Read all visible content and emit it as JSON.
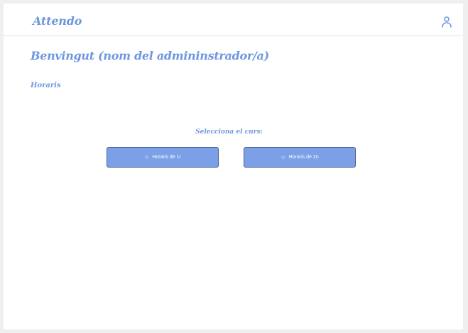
{
  "header": {
    "brand": "Attendo",
    "user_icon": "user-icon"
  },
  "main": {
    "welcome": "Benvingut (nom del admininstrador/a)",
    "section_title": "Horaris",
    "select_label": "Selecciona el curs:",
    "buttons": [
      {
        "icon": "star-icon",
        "label": "Horaris de 1r"
      },
      {
        "icon": "star-icon",
        "label": "Horaris de 2n"
      }
    ]
  },
  "colors": {
    "accent": "#6f97e0",
    "button_bg": "#7ba0e8",
    "button_border": "#4a5f8a",
    "page_bg": "#efefef"
  }
}
